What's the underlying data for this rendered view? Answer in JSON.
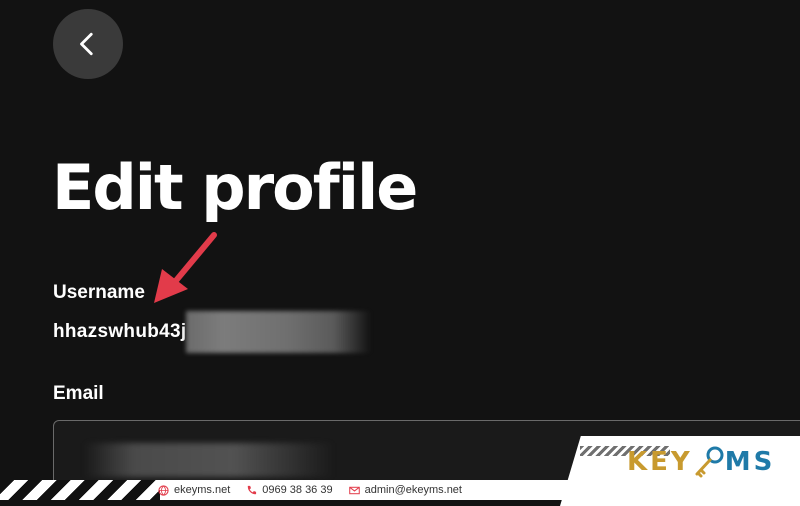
{
  "header": {
    "back_icon": "chevron-left-icon"
  },
  "page": {
    "title": "Edit profile"
  },
  "form": {
    "username_label": "Username",
    "username_value": "hhazswhub43j",
    "email_label": "Email",
    "email_value": ""
  },
  "watermark": {
    "logo_left": "KEY",
    "logo_right": "MS",
    "website": "ekeyms.net",
    "phone": "0969 38 36 39",
    "email": "admin@ekeyms.net"
  },
  "colors": {
    "background": "#121212",
    "annotation_arrow": "#e23b4a",
    "logo_gold": "#c89a2f",
    "logo_blue": "#1f7aa8"
  }
}
